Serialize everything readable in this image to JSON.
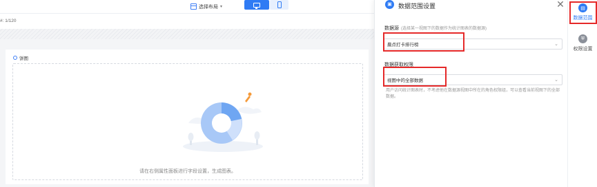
{
  "toolbar": {
    "layout_select_label": "选择布局",
    "layout_icon": "layout-icon",
    "device_desktop_icon": "desktop-icon",
    "device_mobile_icon": "mobile-icon"
  },
  "subbar": {
    "counter": "#: 1/120"
  },
  "chart_card": {
    "title": "饼图",
    "empty_message": "请在右侧属性面板进行字段设置，生成图表。"
  },
  "panel": {
    "title": "数据范围设置",
    "data_source": {
      "label": "数据源",
      "hint": "(选择某一视图下的数据作为统计图表的数据源)",
      "value": "晨点打卡排行榜"
    },
    "permission": {
      "label": "数据获取权限",
      "value": "视图中的全部数据",
      "help": "用户访问统计图表时，不考虑他在数据源视图中所在的角色权限组，可以查看当前视图下的全部数据。"
    }
  },
  "rail": {
    "items": [
      {
        "label": "数据范围",
        "active": true
      },
      {
        "label": "权限设置",
        "active": false
      }
    ]
  },
  "colors": {
    "accent": "#2f7bf4",
    "highlight": "#e52828"
  }
}
